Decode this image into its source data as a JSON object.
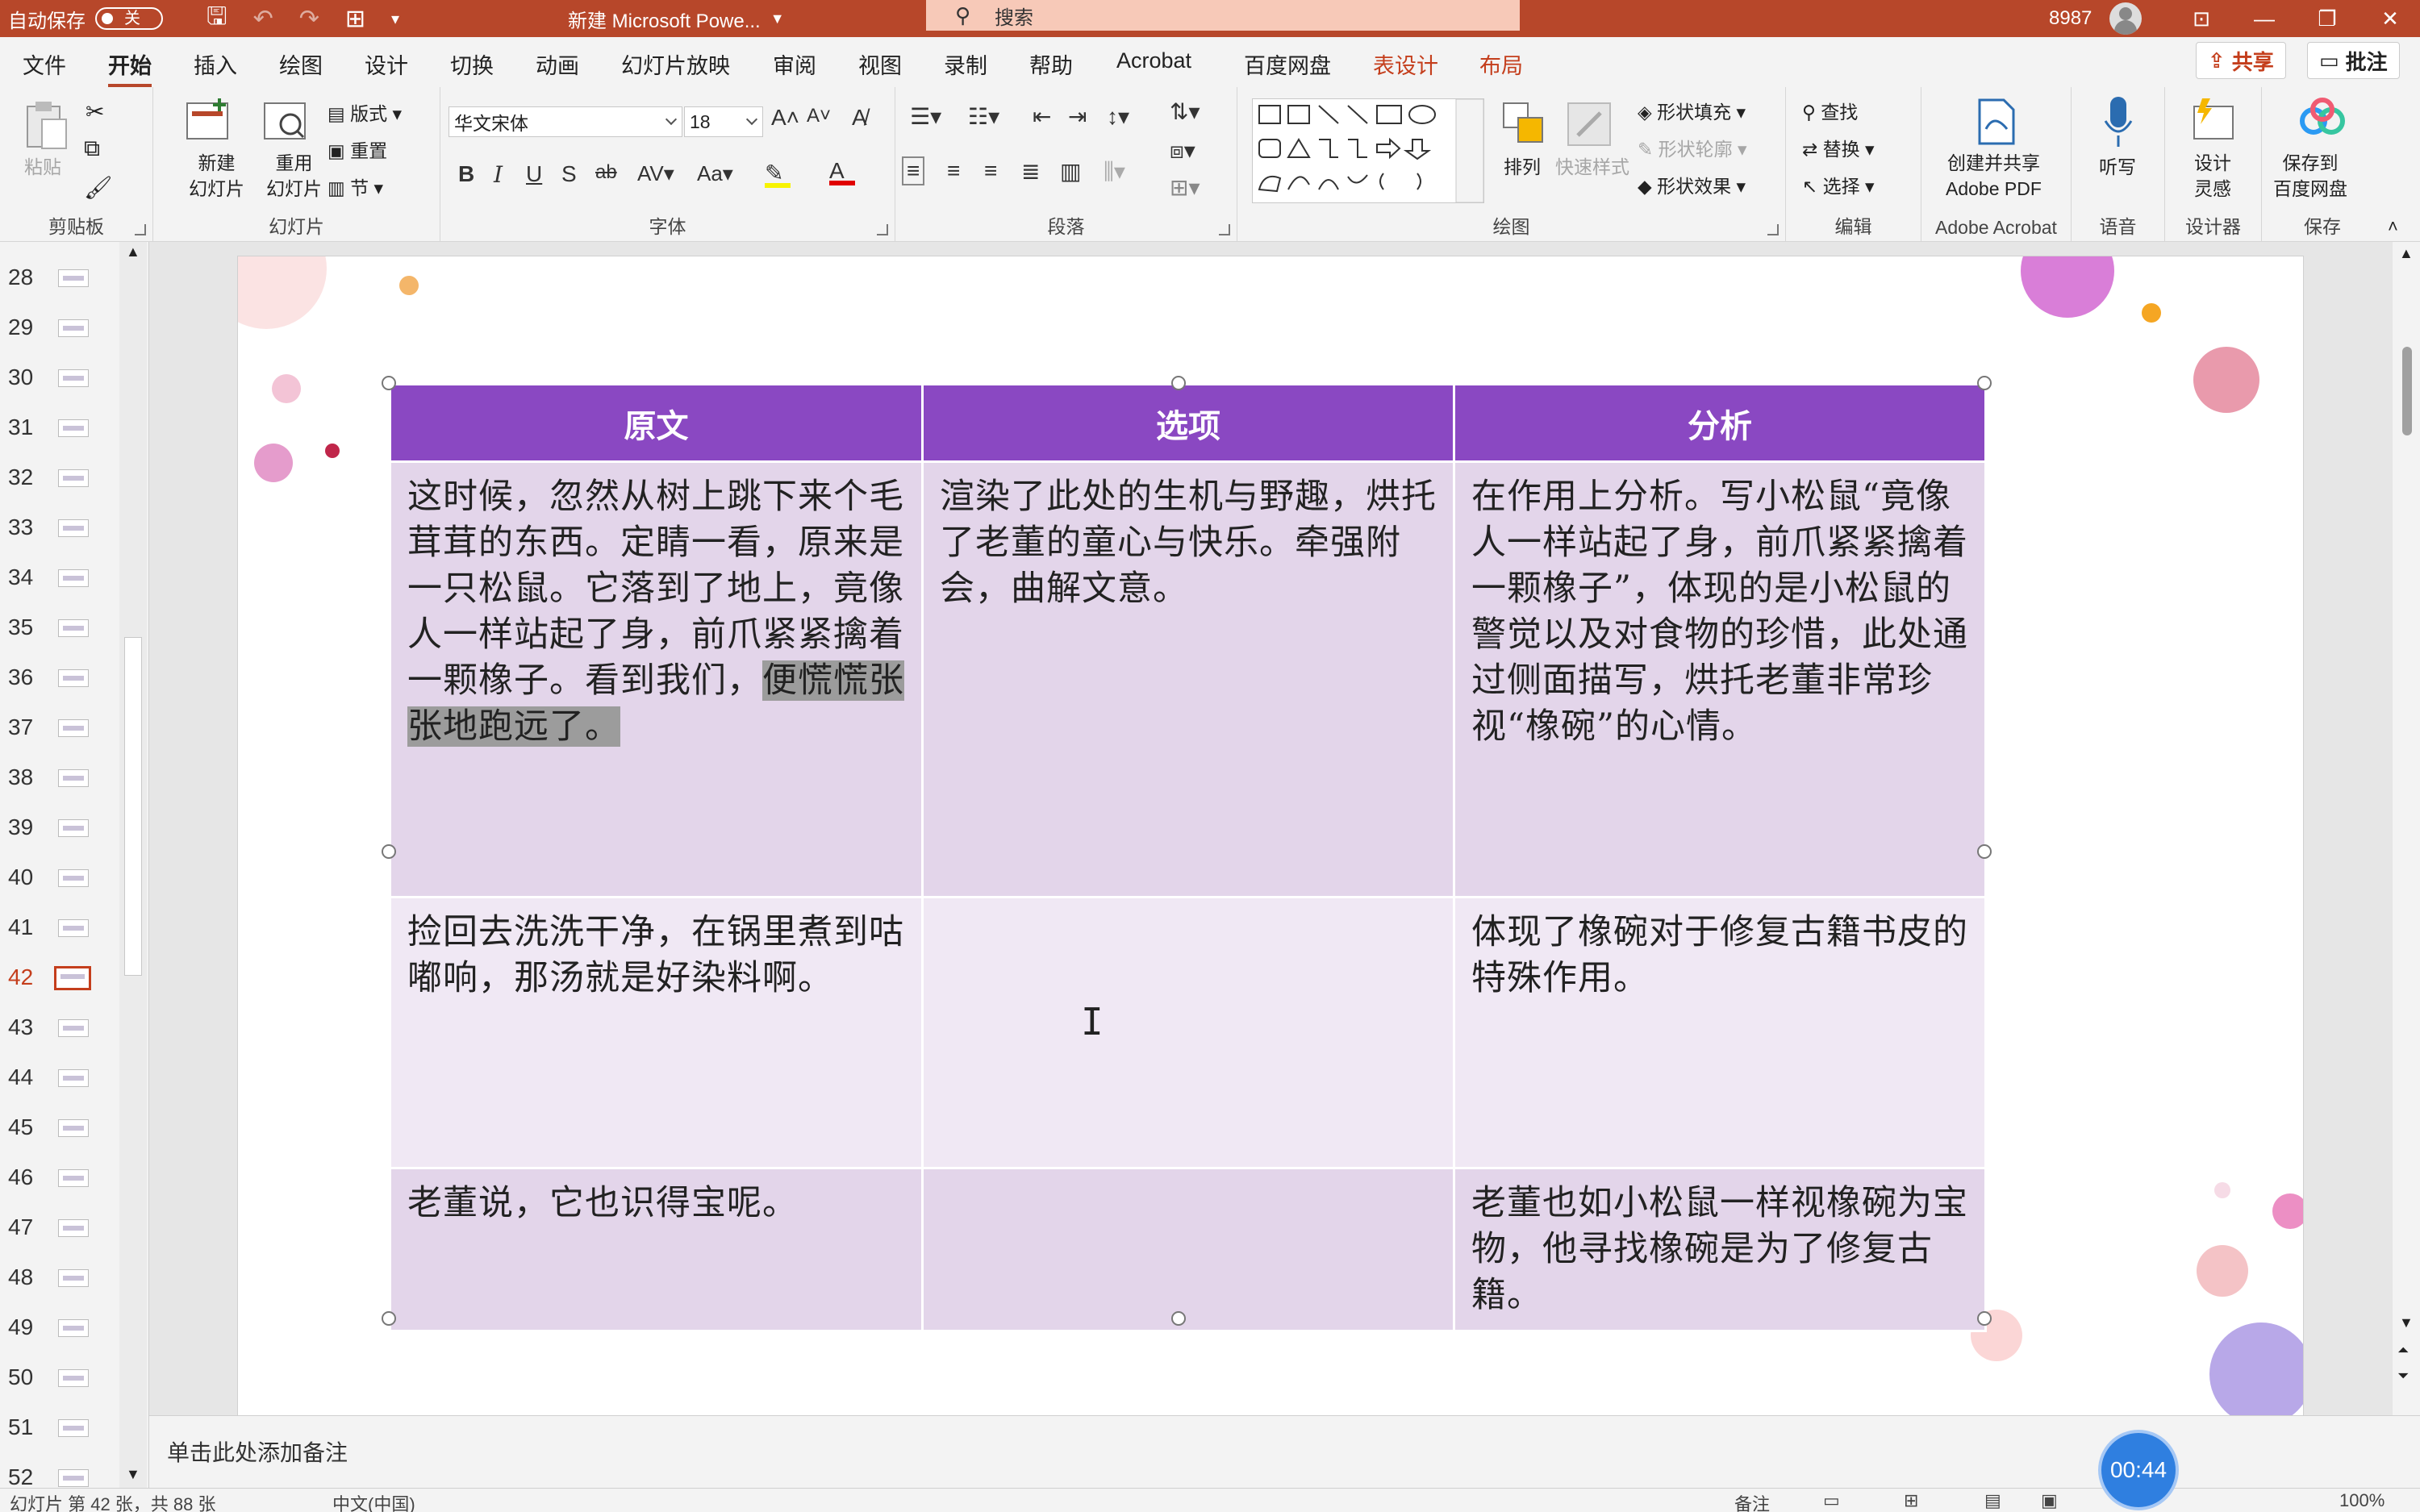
{
  "titlebar": {
    "autosave_label": "自动保存",
    "autosave_state": "关",
    "doc_title": "新建 Microsoft Powe...",
    "search_placeholder": "搜索",
    "user_count": "8987"
  },
  "ribbon_tabs": [
    "文件",
    "开始",
    "插入",
    "绘图",
    "设计",
    "切换",
    "动画",
    "幻灯片放映",
    "审阅",
    "视图",
    "录制",
    "帮助",
    "Acrobat",
    "百度网盘",
    "表设计",
    "布局"
  ],
  "ribbon_actions": {
    "share": "共享",
    "comment": "批注"
  },
  "clipboard": {
    "paste": "粘贴",
    "label": "剪贴板"
  },
  "slides_group": {
    "new_slide": "新建\n幻灯片",
    "reuse": "重用\n幻灯片",
    "layout": "版式",
    "reset": "重置",
    "section": "节",
    "label": "幻灯片"
  },
  "font_group": {
    "font_name": "华文宋体",
    "font_size": "18",
    "label": "字体"
  },
  "paragraph_group": {
    "label": "段落"
  },
  "drawing_group": {
    "arrange": "排列",
    "quick_styles": "快速样式",
    "shape_fill": "形状填充",
    "shape_outline": "形状轮廓",
    "shape_effects": "形状效果",
    "label": "绘图"
  },
  "editing_group": {
    "find": "查找",
    "replace": "替换",
    "select": "选择",
    "label": "编辑"
  },
  "acrobat_group": {
    "create": "创建并共享\nAdobe PDF",
    "label": "Adobe Acrobat"
  },
  "voice_group": {
    "dictate": "听写",
    "label": "语音"
  },
  "designer_group": {
    "design_ideas": "设计\n灵感",
    "label": "设计器"
  },
  "save_group": {
    "save_to": "保存到\n百度网盘",
    "label": "保存"
  },
  "thumbnails": {
    "numbers": [
      "28",
      "29",
      "30",
      "31",
      "32",
      "33",
      "34",
      "35",
      "36",
      "37",
      "38",
      "39",
      "40",
      "41",
      "42",
      "43",
      "44",
      "45",
      "46",
      "47",
      "48",
      "49",
      "50",
      "51",
      "52"
    ],
    "current": "42"
  },
  "table": {
    "headers": [
      "原文",
      "选项",
      "分析"
    ],
    "rows": [
      {
        "c1_a": "这时候，忽然从树上跳下来个毛茸茸的东西。定睛一看，原来是一只松鼠。它落到了地上，竟像人一样站起了身，前爪紧紧擒着一颗橡子。看到我们，",
        "c1_highlight": "便慌慌张张地跑远了。",
        "c2": "渲染了此处的生机与野趣，烘托了老董的童心与快乐。牵强附会，曲解文意。",
        "c3": "在作用上分析。写小松鼠“竟像人一样站起了身，前爪紧紧擒着一颗橡子”，体现的是小松鼠的警觉以及对食物的珍惜，此处通过侧面描写，烘托老董非常珍视“橡碗”的心情。"
      },
      {
        "c1": "捡回去洗洗干净，在锅里煮到咕嘟响，那汤就是好染料啊。",
        "c2": "",
        "c3": "体现了橡碗对于修复古籍书皮的特殊作用。"
      },
      {
        "c1": "老董说，它也识得宝呢。",
        "c2": "",
        "c3": "老董也如小松鼠一样视橡碗为宝物，他寻找橡碗是为了修复古籍。"
      }
    ]
  },
  "notes_placeholder": "单击此处添加备注",
  "status": {
    "slide_info": "幻灯片 第 42 张，共 88 张",
    "language": "中文(中国)",
    "notes": "备注",
    "zoom": "100%"
  },
  "timer": "00:44",
  "colors": {
    "titlebar": "#b7472a",
    "header_purple": "#8a48c2",
    "row_light": "#e3d5ea",
    "row_lighter": "#f0e8f4"
  }
}
